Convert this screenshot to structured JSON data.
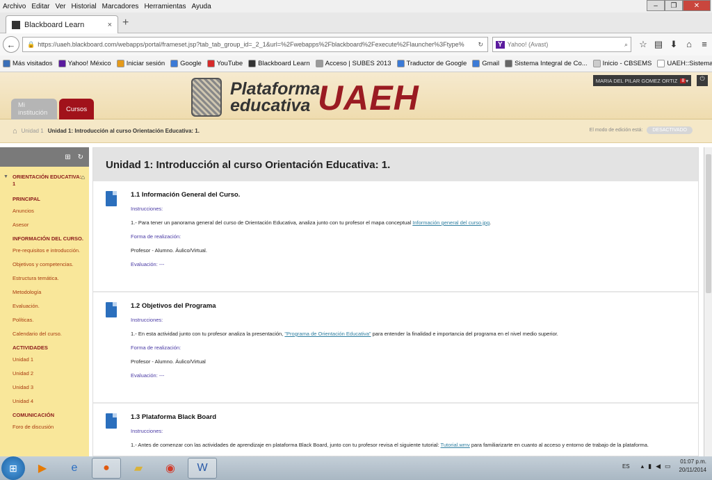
{
  "menubar": {
    "items": [
      "Archivo",
      "Editar",
      "Ver",
      "Historial",
      "Marcadores",
      "Herramientas",
      "Ayuda"
    ]
  },
  "tab": {
    "title": "Blackboard Learn"
  },
  "address": {
    "url": "https://uaeh.blackboard.com/webapps/portal/frameset.jsp?tab_tab_group_id=_2_1&url=%2Fwebapps%2Fblackboard%2Fexecute%2Flauncher%3Ftype%",
    "search_placeholder": "Yahoo! (Avast)"
  },
  "bookmarks": [
    {
      "label": "Más visitados",
      "color": "#3a6fb8"
    },
    {
      "label": "Yahoo! México",
      "color": "#5b1b9e"
    },
    {
      "label": "Iniciar sesión",
      "color": "#e59a1a"
    },
    {
      "label": "Google",
      "color": "#3b7ad6"
    },
    {
      "label": "YouTube",
      "color": "#d62b2b"
    },
    {
      "label": "Blackboard Learn",
      "color": "#333333"
    },
    {
      "label": "Acceso | SUBES 2013",
      "color": "#9a9a9a"
    },
    {
      "label": "Traductor de Google",
      "color": "#3b7ad6"
    },
    {
      "label": "Gmail",
      "color": "#3b7ad6"
    },
    {
      "label": "Sistema Integral de Co...",
      "color": "#666666"
    },
    {
      "label": "Inicio - CBSEMS",
      "color": "#cccccc"
    },
    {
      "label": "UAEH::Sistema Institu...",
      "color": "#ffffff"
    }
  ],
  "header": {
    "tab_institution": "Mi institución",
    "tab_courses": "Cursos",
    "logo_line1": "Plataforma",
    "logo_line2": "educativa",
    "logo_brand": "UAEH",
    "user": "MARIA DEL PILAR GOMEZ ORTIZ",
    "notif_count": "8"
  },
  "breadcrumb": {
    "level1": "Unidad 1",
    "current": "Unidad 1: Introducción al curso Orientación Educativa: 1.",
    "edit_mode": "El modo de edición está:",
    "edit_toggle": "DESACTIVADO"
  },
  "sidebar": {
    "course": "ORIENTACIÓN EDUCATIVA: 1",
    "groups": [
      {
        "header": "PRINCIPAL",
        "items": [
          "Anuncios",
          "Asesor"
        ]
      },
      {
        "header": "INFORMACIÓN DEL CURSO.",
        "items": [
          "Pre-requisitos e introducción.",
          "Objetivos y competencias.",
          "Estructura temática.",
          "Metodología",
          "Evaluación.",
          "Políticas.",
          "Calendario del curso."
        ]
      },
      {
        "header": "ACTIVIDADES",
        "items": [
          "Unidad 1",
          "Unidad 2",
          "Unidad 3",
          "Unidad 4"
        ]
      },
      {
        "header": "COMUNICACIÓN",
        "items": [
          "Foro de discusión"
        ]
      }
    ]
  },
  "content": {
    "title": "Unidad 1: Introducción al curso Orientación Educativa: 1.",
    "items": [
      {
        "title": "1.1 Información General del Curso.",
        "instr_label": "Instrucciones:",
        "instr_text": "1.- Para tener un panorama general del curso de Orientación Educativa, analiza  junto con tu profesor el mapa conceptual ",
        "instr_link": "Información general del curso.jpg",
        "instr_after": ".",
        "form_label": "Forma de realización:",
        "form_text": "Profesor - Alumno. Áulico/Virtual.",
        "eval": "Evaluación:  ---"
      },
      {
        "title": "1.2 Objetivos del Programa",
        "instr_label": "Instrucciones:",
        "instr_text": "1.- En esta actividad junto con tu profesor analiza la presentación, ",
        "instr_link": "\"Programa de Orientación Educativa\"",
        "instr_after": " para entender la finalidad e importancia del programa en el nivel medio superior.",
        "form_label": "Forma de realización:",
        "form_text": "Profesor - Alumno. Áulico/Virtual",
        "eval": "Evaluación: ---"
      },
      {
        "title": "1.3 Plataforma Black Board",
        "instr_label": "Instrucciones:",
        "instr_text": "1.-  Antes de comenzar con las actividades de aprendizaje en plataforma Black Board,  junto con tu  profesor revisa el  siguiente tutorial: ",
        "instr_link": "Tutorial.wmv",
        "instr_after": " para familiarizarte en  cuanto al acceso y entorno de trabajo de la plataforma.",
        "form_label": "",
        "form_text": "",
        "eval": ""
      }
    ]
  },
  "taskbar": {
    "lang": "ES",
    "time": "01:07 p.m.",
    "date": "20/11/2014"
  }
}
